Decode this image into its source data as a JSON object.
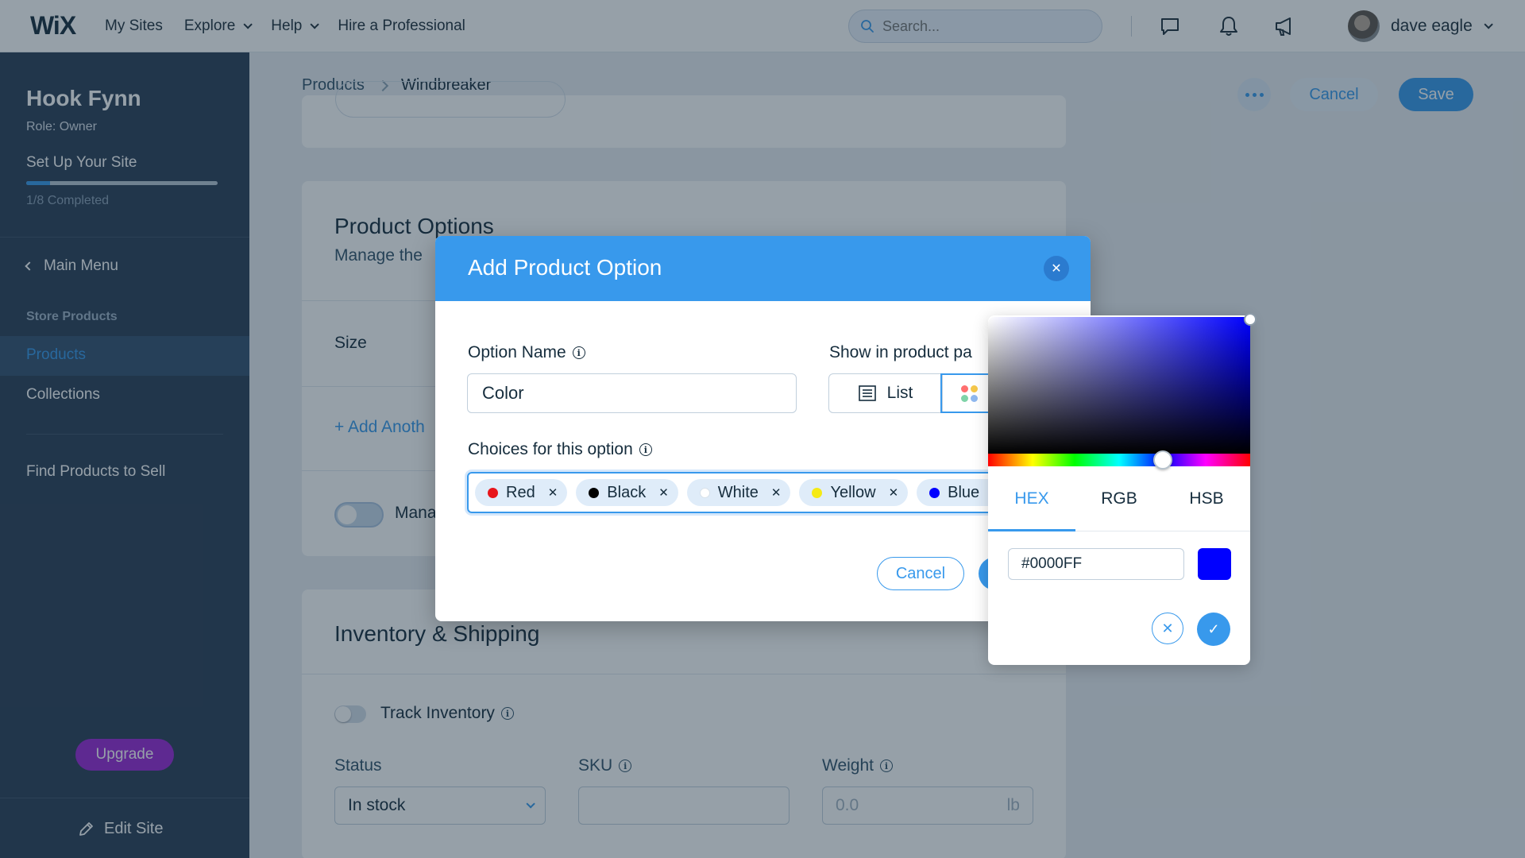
{
  "topbar": {
    "logo": "WiX",
    "nav": [
      {
        "label": "My Sites",
        "dropdown": false
      },
      {
        "label": "Explore",
        "dropdown": true
      },
      {
        "label": "Help",
        "dropdown": true
      },
      {
        "label": "Hire a Professional",
        "dropdown": false
      }
    ],
    "search_placeholder": "Search...",
    "user_name": "dave eagle",
    "icons": [
      "chat-icon",
      "bell-icon",
      "megaphone-icon"
    ]
  },
  "sidebar": {
    "site_name": "Hook Fynn",
    "role": "Role: Owner",
    "setup_title": "Set Up Your Site",
    "setup_progress": 0.125,
    "completed": "1/8 Completed",
    "main_menu": "Main Menu",
    "section_title": "Store Products",
    "items": [
      "Products",
      "Collections"
    ],
    "active_item": "Products",
    "find_products": "Find Products to Sell",
    "upgrade": "Upgrade",
    "edit_site": "Edit Site"
  },
  "page": {
    "breadcrumb": [
      "Products",
      "Windbreaker"
    ],
    "cancel": "Cancel",
    "save": "Save",
    "options_title": "Product Options",
    "options_sub": "Manage the",
    "option_size": "Size",
    "add_another": "+ Add Anoth",
    "manage_label": "Mana",
    "inventory_title": "Inventory & Shipping",
    "track_inventory": "Track Inventory",
    "status_label": "Status",
    "status_value": "In stock",
    "sku_label": "SKU",
    "weight_label": "Weight",
    "weight_placeholder": "0.0",
    "weight_unit": "lb"
  },
  "modal": {
    "title": "Add Product Option",
    "option_name_label": "Option Name",
    "option_name_value": "Color",
    "show_label": "Show in product pa",
    "list_label": "List",
    "color_btn_partial": "C",
    "choices_label": "Choices for this option",
    "choices": [
      {
        "name": "Red",
        "color": "#e8151b"
      },
      {
        "name": "Black",
        "color": "#000000"
      },
      {
        "name": "White",
        "color": "#ffffff"
      },
      {
        "name": "Yellow",
        "color": "#f5ea14"
      },
      {
        "name": "Blue",
        "color": "#0000ff"
      }
    ],
    "cancel": "Cancel"
  },
  "picker": {
    "tabs": [
      "HEX",
      "RGB",
      "HSB"
    ],
    "active_tab": "HEX",
    "hex_value": "#0000FF",
    "swatch_color": "#0000FF"
  },
  "colors": {
    "accent": "#3899ec",
    "sidebar_bg": "#2b3e57",
    "upgrade": "#9a27d5"
  }
}
